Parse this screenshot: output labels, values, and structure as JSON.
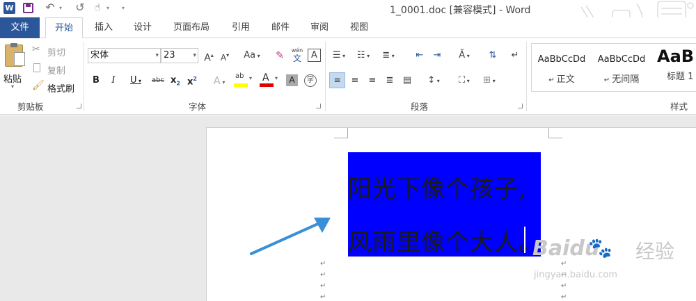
{
  "window": {
    "title": "1_0001.doc [兼容模式] - Word"
  },
  "quick_access": {
    "save_icon": "save-icon",
    "undo_icon": "undo-icon",
    "redo_icon": "redo-icon",
    "touch_icon": "touch-mode-icon"
  },
  "tabs": [
    {
      "label": "文件"
    },
    {
      "label": "开始"
    },
    {
      "label": "插入"
    },
    {
      "label": "设计"
    },
    {
      "label": "页面布局"
    },
    {
      "label": "引用"
    },
    {
      "label": "邮件"
    },
    {
      "label": "审阅"
    },
    {
      "label": "视图"
    }
  ],
  "clipboard": {
    "paste_label": "粘贴",
    "cut_label": "剪切",
    "copy_label": "复制",
    "format_painter_label": "格式刷",
    "group_label": "剪贴板"
  },
  "font": {
    "font_name": "宋体",
    "font_size": "23",
    "group_label": "字体",
    "grow_label": "A",
    "shrink_label": "A",
    "case_label": "Aa",
    "phonetic_top": "wén",
    "phonetic_bottom": "文",
    "border_char": "A",
    "bold": "B",
    "italic": "I",
    "underline": "U",
    "strike": "abc",
    "subscript": "x",
    "superscript": "x",
    "effects": "A",
    "highlight": "ab",
    "color": "A",
    "shading": "A",
    "enclose": "字"
  },
  "paragraph": {
    "group_label": "段落"
  },
  "styles": {
    "group_label": "样式",
    "items": [
      {
        "preview": "AaBbCcDd",
        "name": "正文"
      },
      {
        "preview": "AaBbCcDd",
        "name": "无间隔"
      },
      {
        "preview": "AaB",
        "name": "标题 1"
      }
    ]
  },
  "document": {
    "lines": [
      "阳光下像个孩子,",
      "风雨里像个大人。"
    ],
    "paragraph_mark": "↵"
  },
  "watermark": {
    "brand": "Baidu",
    "brand_cn": "经验",
    "url": "jingyan.baidu.com"
  },
  "colors": {
    "accent": "#2b579a",
    "selection": "#0000ff",
    "arrow": "#3a8fd8",
    "font_color_bar": "#e00000",
    "highlight_bar": "#ffff00"
  }
}
